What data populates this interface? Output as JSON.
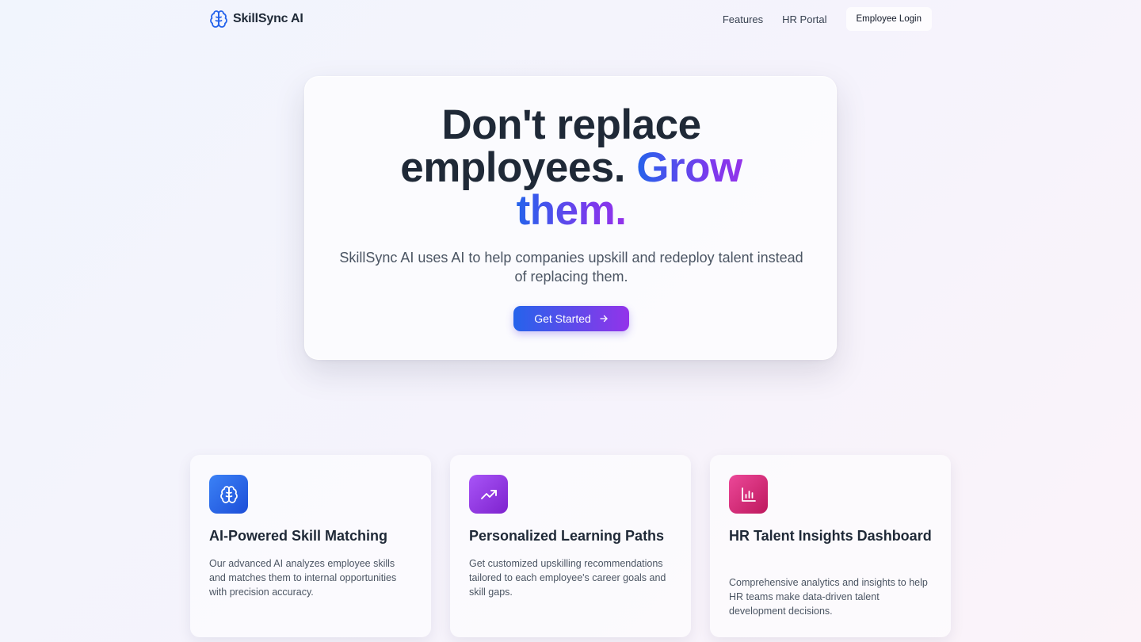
{
  "nav": {
    "brand_name": "SkillSync AI",
    "brand_icon": "brain-icon",
    "links": [
      "Features",
      "HR Portal"
    ],
    "login_label": "Employee Login"
  },
  "hero": {
    "title_line1": "Don't replace",
    "title_line2_plain": "employees.",
    "title_line2_accent": "Grow",
    "title_line3_accent": "them.",
    "subtitle": "SkillSync AI uses AI to help companies upskill and redeploy talent instead of replacing them.",
    "cta_label": "Get Started",
    "cta_icon": "arrow-right-icon"
  },
  "features": [
    {
      "icon": "brain-icon",
      "title": "AI-Powered Skill Matching",
      "description": "Our advanced AI analyzes employee skills and matches them to internal opportunities with precision accuracy."
    },
    {
      "icon": "trending-up-icon",
      "title": "Personalized Learning Paths",
      "description": "Get customized upskilling recommendations tailored to each employee's career goals and skill gaps."
    },
    {
      "icon": "bar-chart-icon",
      "title": "HR Talent Insights Dashboard",
      "description": "Comprehensive analytics and insights to help HR teams make data-driven talent development decisions."
    }
  ],
  "colors": {
    "accent_blue": "#2563eb",
    "accent_purple": "#9333ea",
    "icon_blue": "#3b82f6",
    "icon_purple": "#a855f7",
    "icon_pink": "#ec4899",
    "text_dark": "#1f2937"
  }
}
